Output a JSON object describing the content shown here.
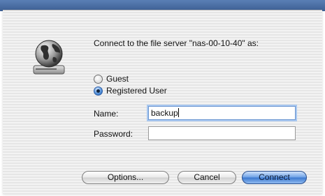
{
  "prompt": "Connect to the file server \"nas-00-10-40\" as:",
  "options": [
    {
      "label": "Guest",
      "selected": false
    },
    {
      "label": "Registered User",
      "selected": true
    }
  ],
  "fields": {
    "name": {
      "label": "Name:",
      "value": "backup"
    },
    "password": {
      "label": "Password:",
      "value": ""
    }
  },
  "buttons": {
    "options": "Options...",
    "cancel": "Cancel",
    "connect": "Connect"
  },
  "icons": {
    "server": "globe-server-icon"
  },
  "colors": {
    "accent": "#3b78cf",
    "focus_ring": "#a9c8f0"
  }
}
